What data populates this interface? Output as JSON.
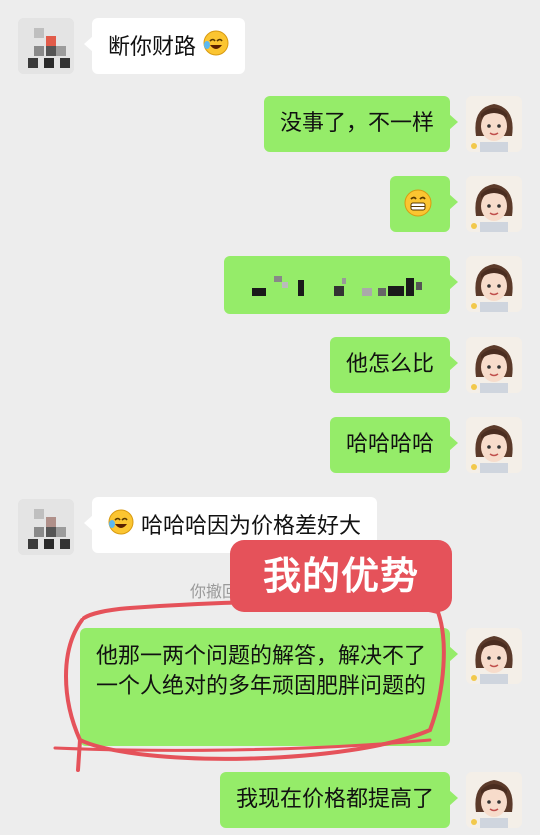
{
  "messages": [
    {
      "side": "left",
      "text": "断你财路",
      "emoji": "face-with-tears-of-joy"
    },
    {
      "side": "right",
      "text": "没事了，不一样"
    },
    {
      "side": "right",
      "emoji": "grinning-face"
    },
    {
      "side": "right",
      "text": "",
      "note": "pixelated"
    },
    {
      "side": "right",
      "text": "他怎么比"
    },
    {
      "side": "right",
      "text": "哈哈哈哈"
    },
    {
      "side": "left",
      "text": "哈哈哈因为价格差好大",
      "emoji": "face-with-tears-of-joy"
    },
    {
      "side": "right",
      "text": "他那一两个问题的解答，解决不了一个人绝对的多年顽固肥胖问题的"
    },
    {
      "side": "right",
      "text": "我现在价格都提高了"
    }
  ],
  "system": {
    "recall_text": "你撤回"
  },
  "overlay": {
    "label": "我的优势",
    "color": "#e5525a"
  },
  "colors": {
    "background": "#ededed",
    "bubble_self": "#95ec69",
    "bubble_other": "#ffffff",
    "annotation": "#e5525a"
  }
}
